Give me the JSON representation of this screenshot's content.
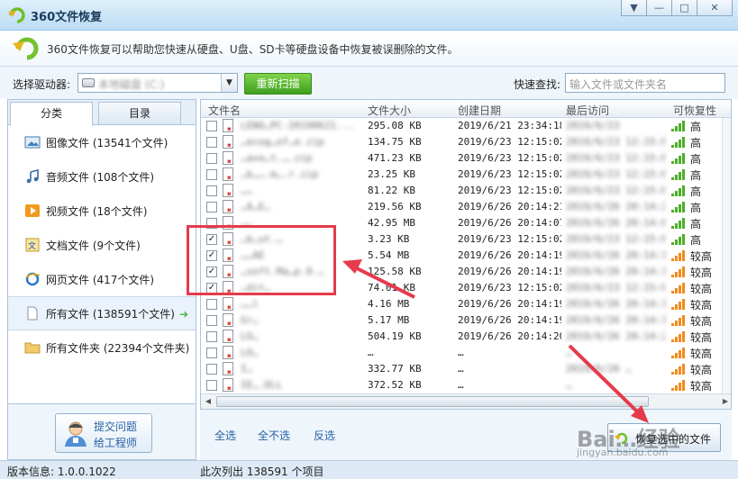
{
  "window": {
    "title": "360文件恢复"
  },
  "banner": {
    "description": "360文件恢复可以帮助您快速从硬盘、U盘、SD卡等硬盘设备中恢复被误删除的文件。"
  },
  "toolbar": {
    "drive_label": "选择驱动器:",
    "drive_value": "本地磁盘 (C:)",
    "rescan_label": "重新扫描",
    "quick_search_label": "快速查找:",
    "quick_search_placeholder": "输入文件或文件夹名"
  },
  "tabs": [
    {
      "label": "分类"
    },
    {
      "label": "目录"
    }
  ],
  "categories": [
    {
      "label": "图像文件 (13541个文件)",
      "icon": "image-icon"
    },
    {
      "label": "音频文件 (108个文件)",
      "icon": "music-icon"
    },
    {
      "label": "视频文件 (18个文件)",
      "icon": "video-icon"
    },
    {
      "label": "文档文件 (9个文件)",
      "icon": "document-icon"
    },
    {
      "label": "网页文件 (417个文件)",
      "icon": "web-icon"
    },
    {
      "label": "所有文件 (138591个文件)",
      "icon": "file-icon",
      "selected": true
    },
    {
      "label": "所有文件夹 (22394个文件夹)",
      "icon": "folder-icon"
    }
  ],
  "help": {
    "line1": "提交问题",
    "line2": "给工程师"
  },
  "columns": {
    "name": "文件名",
    "size": "文件大小",
    "created": "创建日期",
    "last_access": "最后访问",
    "recoverability": "可恢复性"
  },
  "files": [
    {
      "name": "LENO…PC-20190621...",
      "size": "295.08 KB",
      "created": "2019/6/21 23:34:18",
      "accessed": "2019/6/23",
      "rec": "高",
      "level": "high",
      "checked": false
    },
    {
      "name": "…ecog…of…e.zip",
      "size": "134.75 KB",
      "created": "2019/6/23 12:15:02",
      "accessed": "2019/6/23 12:15:0",
      "rec": "高",
      "level": "high",
      "checked": false
    },
    {
      "name": "…avo…t.….zip",
      "size": "471.23 KB",
      "created": "2019/6/23 12:15:02",
      "accessed": "2019/6/23 12:15:0",
      "rec": "高",
      "level": "high",
      "checked": false
    },
    {
      "name": "…b…….m….r.zip",
      "size": "23.25 KB",
      "created": "2019/6/23 12:15:02",
      "accessed": "2019/6/23 12:15:0",
      "rec": "高",
      "level": "high",
      "checked": false
    },
    {
      "name": "……",
      "size": "81.22 KB",
      "created": "2019/6/23 12:15:02",
      "accessed": "2019/6/23 12:15:0",
      "rec": "高",
      "level": "high",
      "checked": false
    },
    {
      "name": "…A…E…",
      "size": "219.56 KB",
      "created": "2019/6/26 20:14:21",
      "accessed": "2019/6/26 20:14:2",
      "rec": "高",
      "level": "high",
      "checked": false
    },
    {
      "name": "……",
      "size": "42.95 MB",
      "created": "2019/6/26 20:14:07",
      "accessed": "2019/6/26 20:14:0",
      "rec": "高",
      "level": "high",
      "checked": false
    },
    {
      "name": "…b…ut.…",
      "size": "3.23 KB",
      "created": "2019/6/23 12:15:02",
      "accessed": "2019/6/23 12:15:0",
      "rec": "高",
      "level": "high",
      "checked": true
    },
    {
      "name": "……AE",
      "size": "5.54 MB",
      "created": "2019/6/26 20:14:19",
      "accessed": "2019/6/26 20:14:19",
      "rec": "较高",
      "level": "mid",
      "checked": true
    },
    {
      "name": "…soft.Ma…p.0.…",
      "size": "125.58 KB",
      "created": "2019/6/26 20:14:19",
      "accessed": "2019/6/26 20:14:19",
      "rec": "较高",
      "level": "mid",
      "checked": true
    },
    {
      "name": "…dit…",
      "size": "74.01 KB",
      "created": "2019/6/23 12:15:02",
      "accessed": "2019/6/23 12:15:02",
      "rec": "较高",
      "level": "mid",
      "checked": true
    },
    {
      "name": "……l",
      "size": "4.16 MB",
      "created": "2019/6/26 20:14:19",
      "accessed": "2019/6/26 20:14:19",
      "rec": "较高",
      "level": "mid",
      "checked": false
    },
    {
      "name": "Gr…",
      "size": "5.17 MB",
      "created": "2019/6/26 20:14:19",
      "accessed": "2019/6/26 20:14:19",
      "rec": "较高",
      "level": "mid",
      "checked": false
    },
    {
      "name": "LO…",
      "size": "504.19 KB",
      "created": "2019/6/26 20:14:20",
      "accessed": "2019/6/26 20:14:20",
      "rec": "较高",
      "level": "mid",
      "checked": false
    },
    {
      "name": "LO…",
      "size": "…",
      "created": "…",
      "accessed": "…",
      "rec": "较高",
      "level": "mid",
      "checked": false
    },
    {
      "name": "I…",
      "size": "332.77 KB",
      "created": "…",
      "accessed": "2019/6/26 …",
      "rec": "较高",
      "level": "mid",
      "checked": false
    },
    {
      "name": "IE….DLL",
      "size": "372.52 KB",
      "created": "…",
      "accessed": "…",
      "rec": "较高",
      "level": "mid",
      "checked": false
    }
  ],
  "actions": {
    "select_all": "全选",
    "select_none": "全不选",
    "invert": "反选",
    "restore": "恢复选中的文件"
  },
  "status": {
    "version": "版本信息: 1.0.0.1022",
    "count": "此次列出 138591 个项目"
  },
  "watermark": {
    "text": "Bai…经验",
    "url": "jingyan.baidu.com"
  },
  "colors": {
    "accent_green": "#3f9f1e",
    "high_bars": "#4caf2a",
    "mid_bars": "#f28a1c",
    "annotation": "#e53b4a"
  }
}
